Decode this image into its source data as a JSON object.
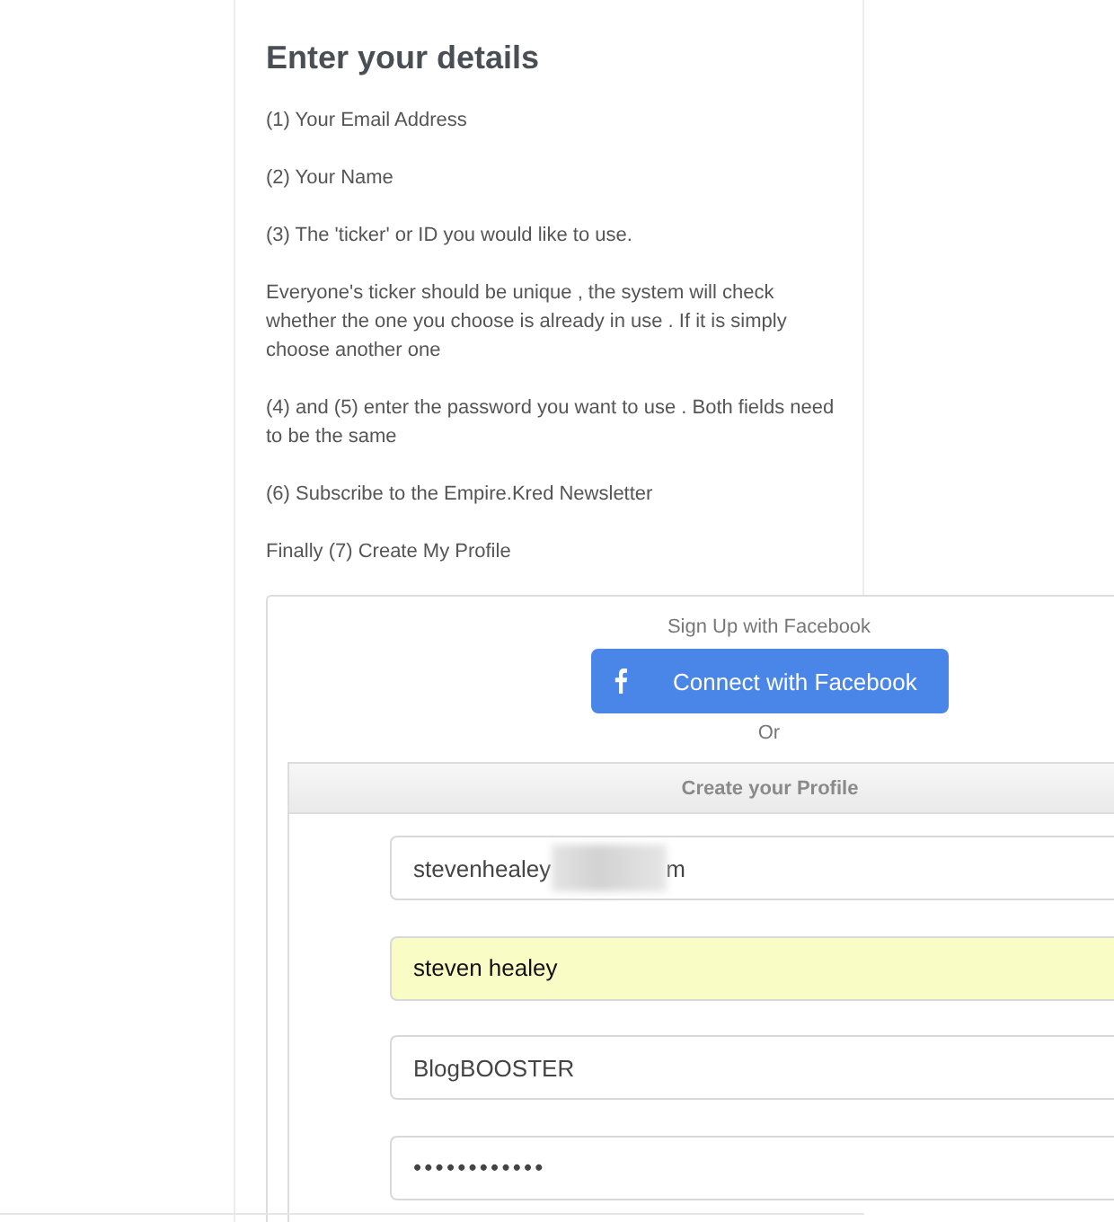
{
  "heading": "Enter your details",
  "instructions": [
    "(1) Your Email Address",
    "(2) Your Name",
    "(3) The 'ticker' or ID you would like to use.",
    "Everyone's ticker should be unique , the system will check whether the one you choose is already in use . If it is simply choose another one",
    "(4) and (5) enter the password you want to use . Both fields need to be the same",
    "(6) Subscribe to the Empire.Kred Newsletter",
    "Finally (7) Create My Profile"
  ],
  "form": {
    "facebook_label": "Sign Up with Facebook",
    "facebook_button": "Connect with Facebook",
    "separator": "Or",
    "section_title": "Create your Profile",
    "fields": [
      {
        "kind": "email",
        "value": "stevenhealey",
        "redacted": true,
        "value_end": "m",
        "autofilled": false
      },
      {
        "kind": "name",
        "value": "steven healey",
        "redacted": false,
        "autofilled": true
      },
      {
        "kind": "ticker",
        "value": "BlogBOOSTER",
        "redacted": false,
        "autofilled": false
      },
      {
        "kind": "password",
        "value": "••••••••••••",
        "redacted": false,
        "autofilled": false
      }
    ]
  }
}
